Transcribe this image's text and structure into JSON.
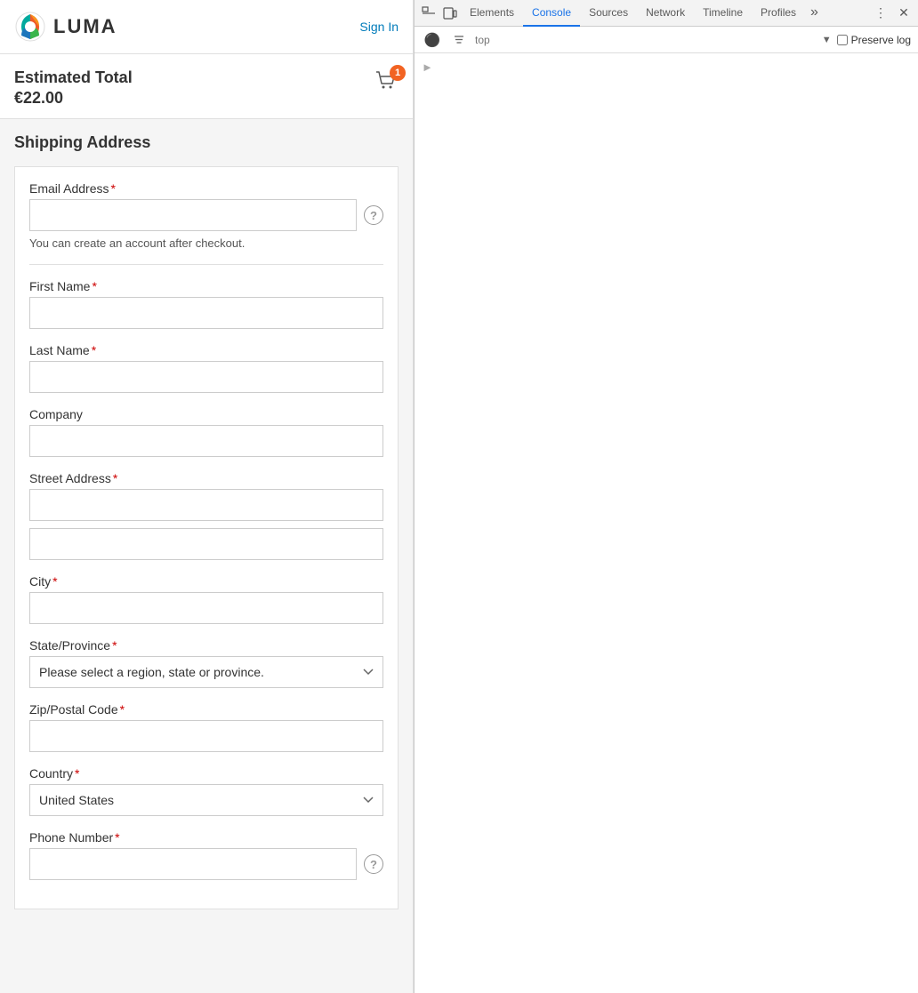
{
  "header": {
    "logo_text": "LUMA",
    "sign_in_label": "Sign In"
  },
  "cart": {
    "estimated_total_label": "Estimated Total",
    "amount": "€22.00",
    "badge_count": "1"
  },
  "form": {
    "shipping_address_title": "Shipping Address",
    "email_label": "Email Address",
    "email_hint": "You can create an account after checkout.",
    "first_name_label": "First Name",
    "last_name_label": "Last Name",
    "company_label": "Company",
    "street_address_label": "Street Address",
    "city_label": "City",
    "state_label": "State/Province",
    "state_placeholder": "Please select a region, state or province.",
    "zip_label": "Zip/Postal Code",
    "country_label": "Country",
    "country_value": "United States",
    "phone_label": "Phone Number"
  },
  "devtools": {
    "tabs": [
      "Elements",
      "Console",
      "Sources",
      "Network",
      "Timeline",
      "Profiles"
    ],
    "active_tab": "Console",
    "console_filter_placeholder": "top",
    "preserve_log_label": "Preserve log"
  }
}
